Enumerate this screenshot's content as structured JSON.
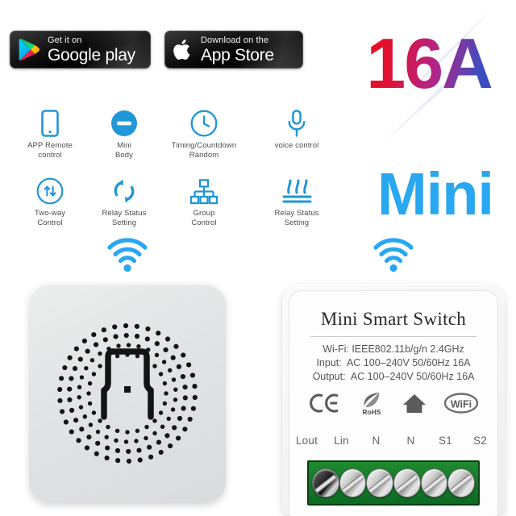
{
  "background_color": "#ffffff",
  "store_badges": [
    {
      "icon": "google-play-icon",
      "small_text": "Get it on",
      "big_text": "Google play"
    },
    {
      "icon": "apple-logo-icon",
      "small_text": "Download on the",
      "big_text": "App Store"
    }
  ],
  "headline": {
    "amperage": "16A",
    "amperage_gradient_from": "#ee1111",
    "amperage_gradient_to": "#2b3fb5",
    "bolt_icon": "lightning-bolt-icon",
    "mini": "Mini",
    "mini_color": "#29a7f0"
  },
  "features": {
    "accent_color": "#2196d8",
    "row1": [
      {
        "icon": "smartphone-icon",
        "label": "APP Remote\ncontrol"
      },
      {
        "icon": "minus-circle-icon",
        "label": "Mini\nBody"
      },
      {
        "icon": "clock-icon",
        "label": "Timing/Countdown\nRandom"
      },
      {
        "icon": "microphone-icon",
        "label": "voice control"
      }
    ],
    "row2": [
      {
        "icon": "two-way-arrows-circle-icon",
        "label": "Two-way\nControl"
      },
      {
        "icon": "refresh-cycle-icon",
        "label": "Relay Status\nSetting"
      },
      {
        "icon": "hierarchy-group-icon",
        "label": "Group\nControl"
      },
      {
        "icon": "heat-waves-icon",
        "label": "Relay Status\nSetting"
      }
    ]
  },
  "wifi_marks": [
    {
      "icon": "wifi-icon",
      "color": "#29a7f0"
    },
    {
      "icon": "wifi-icon",
      "color": "#29a7f0"
    }
  ],
  "device_left": {
    "name": "smart-switch-front-cover",
    "center_icon": "power-plug-outline-icon",
    "dot_pattern": "perforated-ring-dots"
  },
  "device_right": {
    "title": "Mini  Smart Switch",
    "specs": [
      "Wi-Fi: IEEE802.11b/g/n 2.4GHz",
      "Input:  AC 100–240V 50/60Hz 16A",
      "Output:  AC 100–240V 50/60Hz 16A"
    ],
    "certifications": [
      {
        "icon": "ce-mark-icon",
        "label": "CE"
      },
      {
        "icon": "rohs-leaf-icon",
        "label": "RoHS"
      },
      {
        "icon": "home-house-icon",
        "label": "Home"
      },
      {
        "icon": "wifi-badge-icon",
        "label": "WiFi"
      }
    ],
    "terminals": [
      "Lout",
      "Lin",
      "N",
      "N",
      "S1",
      "S2"
    ],
    "terminal_block_color": "#14782a",
    "screw_count": 6
  }
}
